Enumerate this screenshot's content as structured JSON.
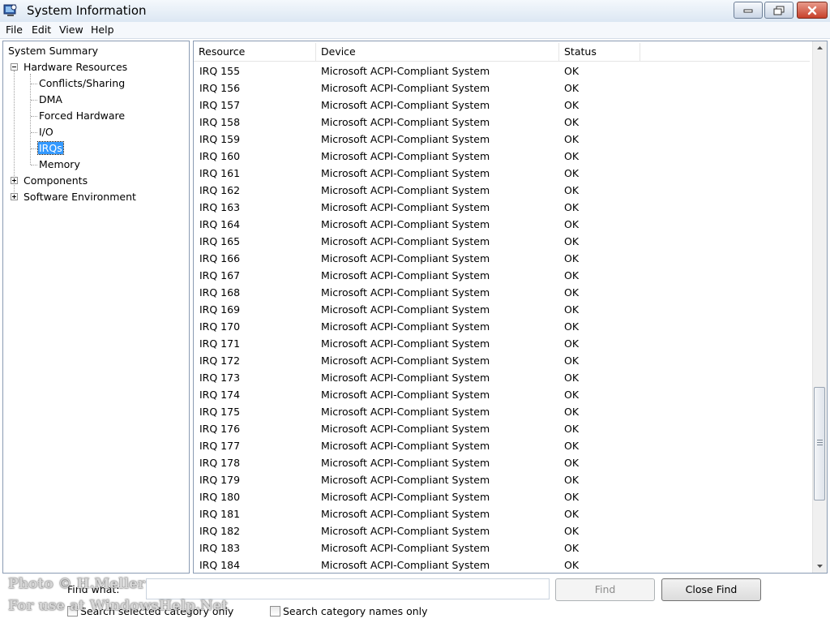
{
  "window": {
    "title": "System Information",
    "icon": "system-information-app-icon"
  },
  "menu": {
    "file": "File",
    "edit": "Edit",
    "view": "View",
    "help": "Help"
  },
  "tree": {
    "root": "System Summary",
    "hardware": "Hardware Resources",
    "hardware_children": [
      "Conflicts/Sharing",
      "DMA",
      "Forced Hardware",
      "I/O",
      "IRQs",
      "Memory"
    ],
    "selected": "IRQs",
    "components": "Components",
    "software": "Software Environment"
  },
  "list": {
    "columns": [
      "Resource",
      "Device",
      "Status"
    ],
    "rows": [
      [
        "IRQ 155",
        "Microsoft ACPI-Compliant System",
        "OK"
      ],
      [
        "IRQ 156",
        "Microsoft ACPI-Compliant System",
        "OK"
      ],
      [
        "IRQ 157",
        "Microsoft ACPI-Compliant System",
        "OK"
      ],
      [
        "IRQ 158",
        "Microsoft ACPI-Compliant System",
        "OK"
      ],
      [
        "IRQ 159",
        "Microsoft ACPI-Compliant System",
        "OK"
      ],
      [
        "IRQ 160",
        "Microsoft ACPI-Compliant System",
        "OK"
      ],
      [
        "IRQ 161",
        "Microsoft ACPI-Compliant System",
        "OK"
      ],
      [
        "IRQ 162",
        "Microsoft ACPI-Compliant System",
        "OK"
      ],
      [
        "IRQ 163",
        "Microsoft ACPI-Compliant System",
        "OK"
      ],
      [
        "IRQ 164",
        "Microsoft ACPI-Compliant System",
        "OK"
      ],
      [
        "IRQ 165",
        "Microsoft ACPI-Compliant System",
        "OK"
      ],
      [
        "IRQ 166",
        "Microsoft ACPI-Compliant System",
        "OK"
      ],
      [
        "IRQ 167",
        "Microsoft ACPI-Compliant System",
        "OK"
      ],
      [
        "IRQ 168",
        "Microsoft ACPI-Compliant System",
        "OK"
      ],
      [
        "IRQ 169",
        "Microsoft ACPI-Compliant System",
        "OK"
      ],
      [
        "IRQ 170",
        "Microsoft ACPI-Compliant System",
        "OK"
      ],
      [
        "IRQ 171",
        "Microsoft ACPI-Compliant System",
        "OK"
      ],
      [
        "IRQ 172",
        "Microsoft ACPI-Compliant System",
        "OK"
      ],
      [
        "IRQ 173",
        "Microsoft ACPI-Compliant System",
        "OK"
      ],
      [
        "IRQ 174",
        "Microsoft ACPI-Compliant System",
        "OK"
      ],
      [
        "IRQ 175",
        "Microsoft ACPI-Compliant System",
        "OK"
      ],
      [
        "IRQ 176",
        "Microsoft ACPI-Compliant System",
        "OK"
      ],
      [
        "IRQ 177",
        "Microsoft ACPI-Compliant System",
        "OK"
      ],
      [
        "IRQ 178",
        "Microsoft ACPI-Compliant System",
        "OK"
      ],
      [
        "IRQ 179",
        "Microsoft ACPI-Compliant System",
        "OK"
      ],
      [
        "IRQ 180",
        "Microsoft ACPI-Compliant System",
        "OK"
      ],
      [
        "IRQ 181",
        "Microsoft ACPI-Compliant System",
        "OK"
      ],
      [
        "IRQ 182",
        "Microsoft ACPI-Compliant System",
        "OK"
      ],
      [
        "IRQ 183",
        "Microsoft ACPI-Compliant System",
        "OK"
      ],
      [
        "IRQ 184",
        "Microsoft ACPI-Compliant System",
        "OK"
      ]
    ],
    "scroll_position": 0.85
  },
  "find": {
    "label": "Find what:",
    "value": "",
    "find_button": "Find",
    "close_button": "Close Find",
    "search_selected": "Search selected category only",
    "search_names": "Search category names only"
  },
  "watermark": {
    "line1": "Photo © H.Meller",
    "line2": "For use at WindowsHelp.Net"
  },
  "colors": {
    "selection": "#3399ff",
    "titlebar_top": "#f4f8fc",
    "close_button": "#c7412c"
  }
}
